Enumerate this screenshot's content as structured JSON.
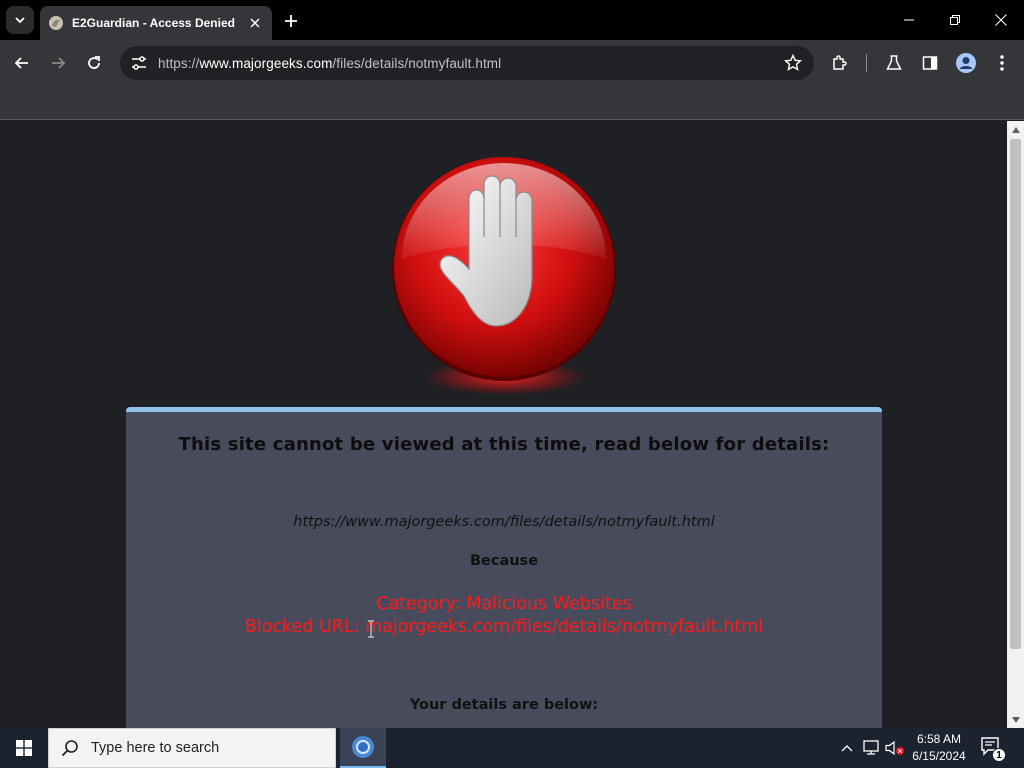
{
  "browser": {
    "tab": {
      "title": "E2Guardian - Access Denied"
    },
    "address_bar": {
      "scheme": "https://",
      "host": "www.majorgeeks.com",
      "path": "/files/details/notmyfault.html"
    }
  },
  "page": {
    "heading": "This site cannot be viewed at this time, read below for details:",
    "blocked_url": "https://www.majorgeeks.com/files/details/notmyfault.html",
    "because_label": "Because",
    "category_line": "Category: Malicious Websites",
    "blocked_url_line": "Blocked URL: majorgeeks.com/files/details/notmyfault.html",
    "details_label": "Your details are below:",
    "accent_color": "#8fc3ec",
    "reason_color": "#ff1a1a"
  },
  "taskbar": {
    "search_placeholder": "Type here to search",
    "time": "6:58 AM",
    "date": "6/15/2024",
    "notification_count": "1"
  }
}
